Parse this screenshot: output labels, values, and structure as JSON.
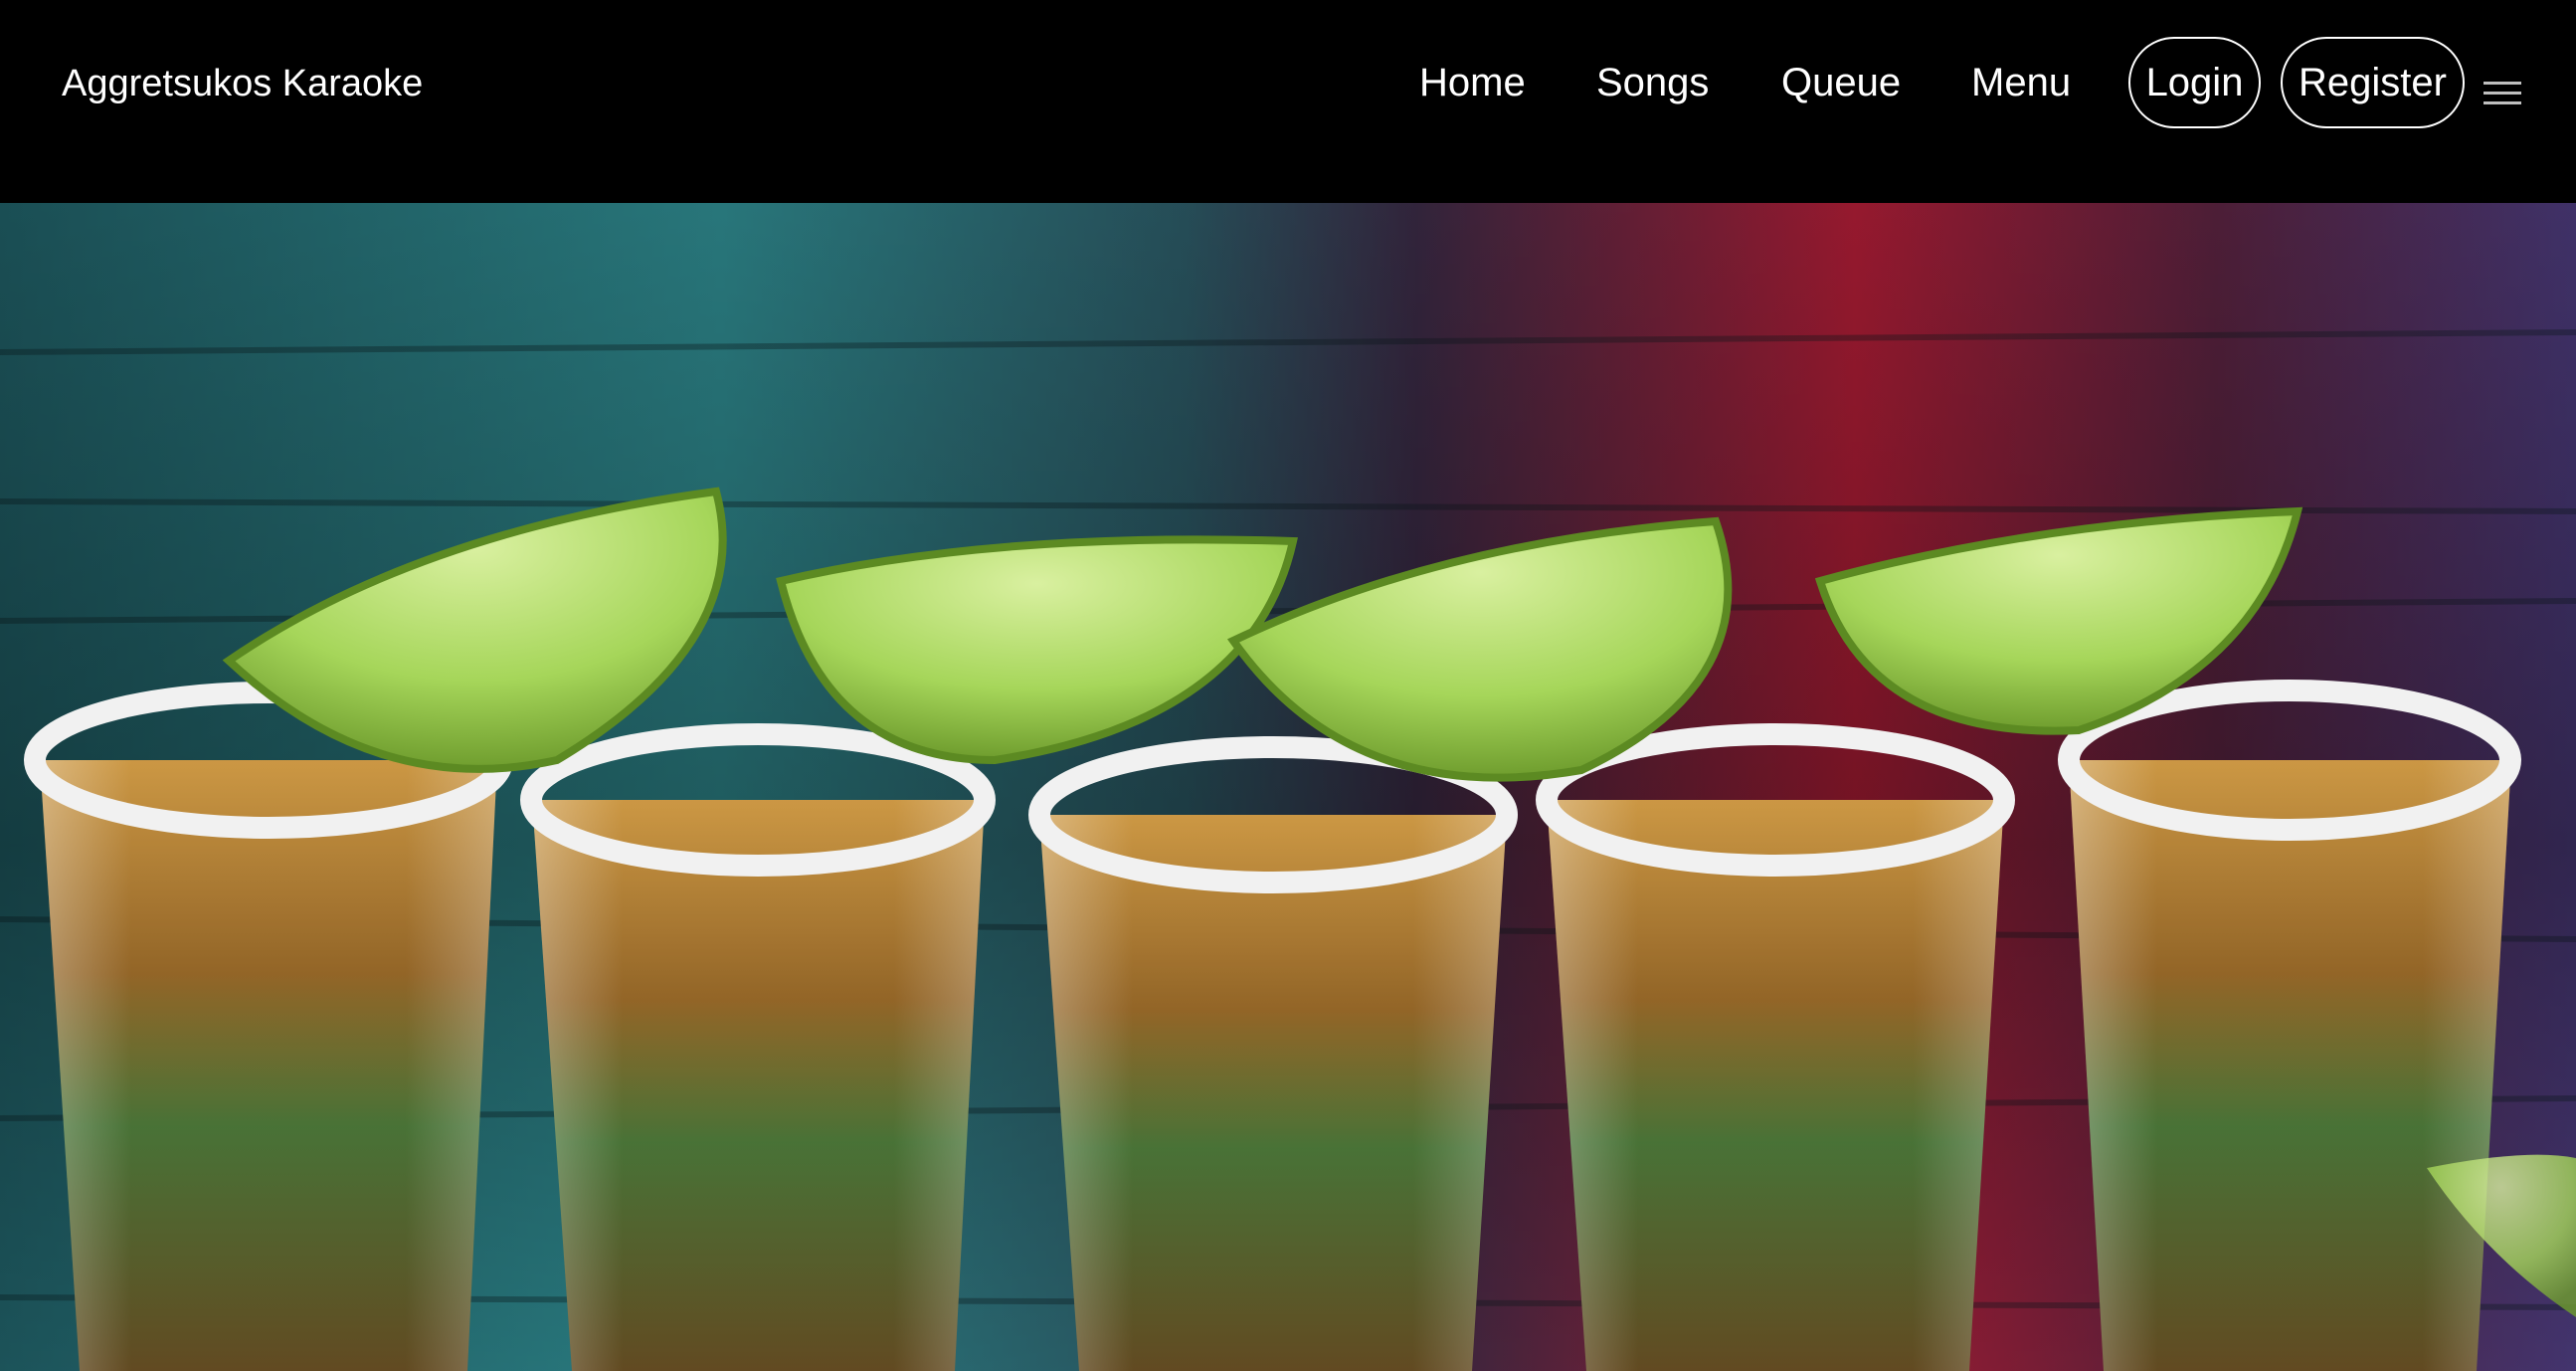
{
  "brand": {
    "title": "Aggretsukos Karaoke"
  },
  "nav": {
    "home": "Home",
    "songs": "Songs",
    "queue": "Queue",
    "menu": "Menu",
    "login": "Login",
    "register": "Register",
    "hamburger_icon": "hamburger-menu-icon"
  },
  "hero": {
    "image": "tequila-shots-with-lime-and-salt-rim",
    "colors": {
      "left_light": "#3bb7c0",
      "right_light": "#c9203a",
      "far_right_light": "#5b3c8c",
      "lime": "#a6d65a",
      "tequila": "#a37322"
    }
  }
}
